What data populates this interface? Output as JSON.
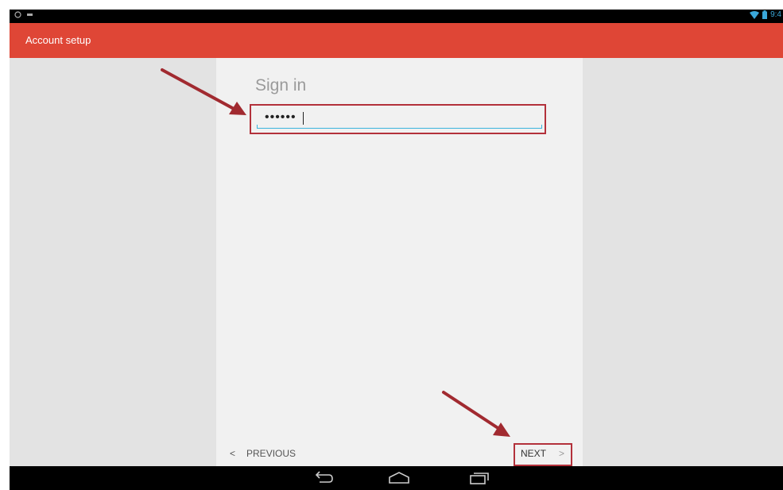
{
  "statusbar": {
    "left_icons": [
      "circle-status-icon",
      "download-status-icon"
    ],
    "time": "9:4",
    "right_icons": [
      "wifi-icon",
      "battery-icon"
    ]
  },
  "appbar": {
    "title": "Account setup"
  },
  "signin": {
    "title": "Sign in",
    "password_value": "••••••"
  },
  "nav": {
    "previous_label": "PREVIOUS",
    "previous_glyph": "<",
    "next_label": "NEXT",
    "next_glyph": ">"
  },
  "systembar": [
    "back-icon",
    "home-icon",
    "recents-icon"
  ],
  "colors": {
    "appbar": "#df4636",
    "highlight": "#b3313b",
    "field_underline": "#3bb4dd"
  }
}
